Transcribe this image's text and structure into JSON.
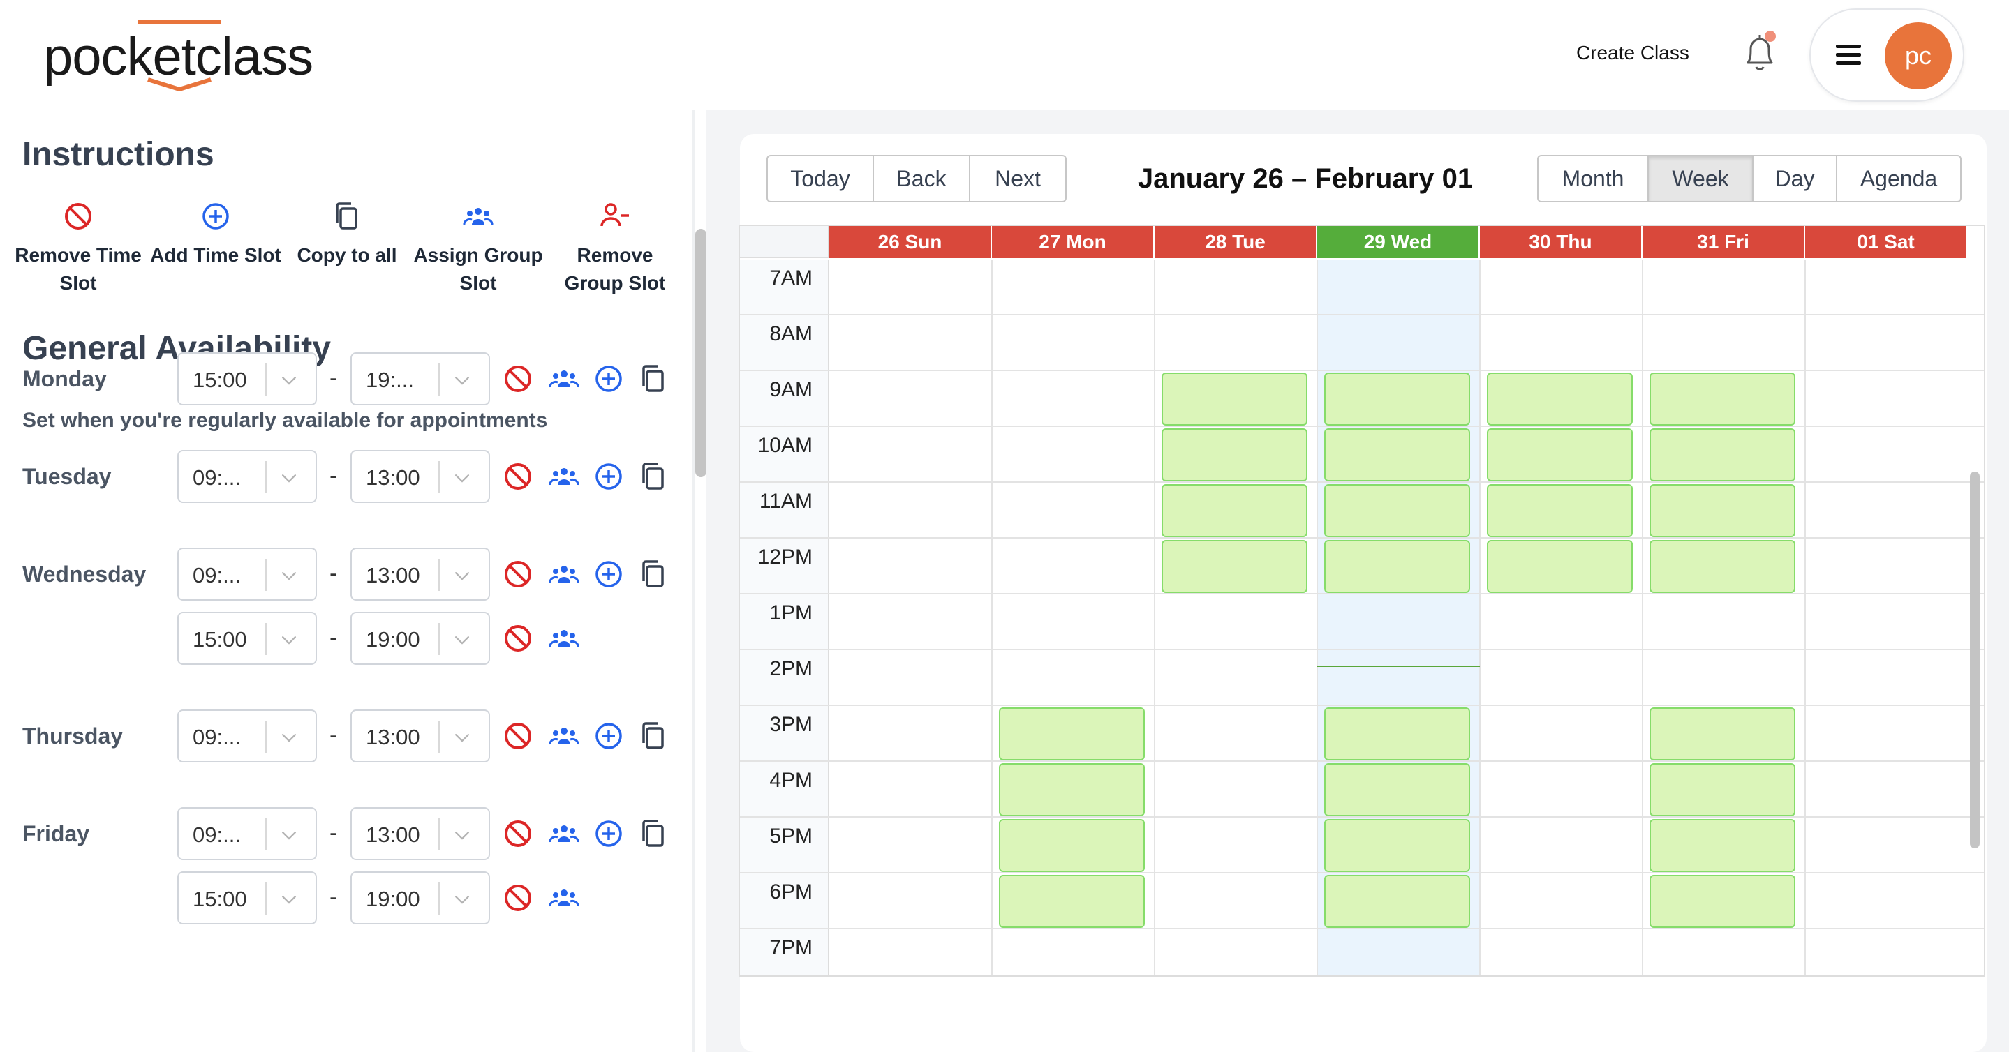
{
  "header": {
    "logo_text": "pocketclass",
    "create_class_label": "Create Class",
    "avatar_text": "pc",
    "accent_color": "#e8743b"
  },
  "instructions": {
    "title": "Instructions",
    "items": [
      {
        "label": "Remove Time Slot",
        "icon": "ban-icon",
        "color": "#dc2626"
      },
      {
        "label": "Add Time Slot",
        "icon": "plus-circle-icon",
        "color": "#2563eb"
      },
      {
        "label": "Copy to all",
        "icon": "copy-icon",
        "color": "#374151"
      },
      {
        "label": "Assign Group Slot",
        "icon": "users-icon",
        "color": "#2563eb"
      },
      {
        "label": "Remove Group Slot",
        "icon": "user-minus-icon",
        "color": "#dc2626"
      }
    ]
  },
  "availability": {
    "title": "General Availability",
    "subtitle": "Set when you're regularly available for appointments",
    "days": [
      {
        "day": "Monday",
        "slots": [
          {
            "start": "15:00",
            "end": "19:..."
          }
        ]
      },
      {
        "day": "Tuesday",
        "slots": [
          {
            "start": "09:...",
            "end": "13:00"
          }
        ]
      },
      {
        "day": "Wednesday",
        "slots": [
          {
            "start": "09:...",
            "end": "13:00"
          },
          {
            "start": "15:00",
            "end": "19:00"
          }
        ]
      },
      {
        "day": "Thursday",
        "slots": [
          {
            "start": "09:...",
            "end": "13:00"
          }
        ]
      },
      {
        "day": "Friday",
        "slots": [
          {
            "start": "09:...",
            "end": "13:00"
          },
          {
            "start": "15:00",
            "end": "19:00"
          }
        ]
      }
    ],
    "separator": "-"
  },
  "calendar": {
    "nav_buttons": [
      "Today",
      "Back",
      "Next"
    ],
    "title": "January 26 – February 01",
    "view_buttons": [
      "Month",
      "Week",
      "Day",
      "Agenda"
    ],
    "active_view": "Week",
    "days": [
      {
        "label": "26 Sun",
        "color": "#d9483b"
      },
      {
        "label": "27 Mon",
        "color": "#d9483b"
      },
      {
        "label": "28 Tue",
        "color": "#d9483b"
      },
      {
        "label": "29 Wed",
        "color": "#55ad3b"
      },
      {
        "label": "30 Thu",
        "color": "#d9483b"
      },
      {
        "label": "31 Fri",
        "color": "#d9483b"
      },
      {
        "label": "01 Sat",
        "color": "#d9483b"
      }
    ],
    "today_index": 3,
    "hours": [
      "7AM",
      "8AM",
      "9AM",
      "10AM",
      "11AM",
      "12PM",
      "1PM",
      "2PM",
      "3PM",
      "4PM",
      "5PM",
      "6PM",
      "7PM"
    ],
    "events": [
      {
        "day": 2,
        "hour": "9AM"
      },
      {
        "day": 2,
        "hour": "10AM"
      },
      {
        "day": 2,
        "hour": "11AM"
      },
      {
        "day": 2,
        "hour": "12PM"
      },
      {
        "day": 3,
        "hour": "9AM"
      },
      {
        "day": 3,
        "hour": "10AM"
      },
      {
        "day": 3,
        "hour": "11AM"
      },
      {
        "day": 3,
        "hour": "12PM"
      },
      {
        "day": 4,
        "hour": "9AM"
      },
      {
        "day": 4,
        "hour": "10AM"
      },
      {
        "day": 4,
        "hour": "11AM"
      },
      {
        "day": 4,
        "hour": "12PM"
      },
      {
        "day": 5,
        "hour": "9AM"
      },
      {
        "day": 5,
        "hour": "10AM"
      },
      {
        "day": 5,
        "hour": "11AM"
      },
      {
        "day": 5,
        "hour": "12PM"
      },
      {
        "day": 1,
        "hour": "3PM"
      },
      {
        "day": 1,
        "hour": "4PM"
      },
      {
        "day": 1,
        "hour": "5PM"
      },
      {
        "day": 1,
        "hour": "6PM"
      },
      {
        "day": 3,
        "hour": "3PM"
      },
      {
        "day": 3,
        "hour": "4PM"
      },
      {
        "day": 3,
        "hour": "5PM"
      },
      {
        "day": 3,
        "hour": "6PM"
      },
      {
        "day": 5,
        "hour": "3PM"
      },
      {
        "day": 5,
        "hour": "4PM"
      },
      {
        "day": 5,
        "hour": "5PM"
      },
      {
        "day": 5,
        "hour": "6PM"
      }
    ],
    "event_fill": "#dbf5b9",
    "event_border": "#86dc6a"
  }
}
